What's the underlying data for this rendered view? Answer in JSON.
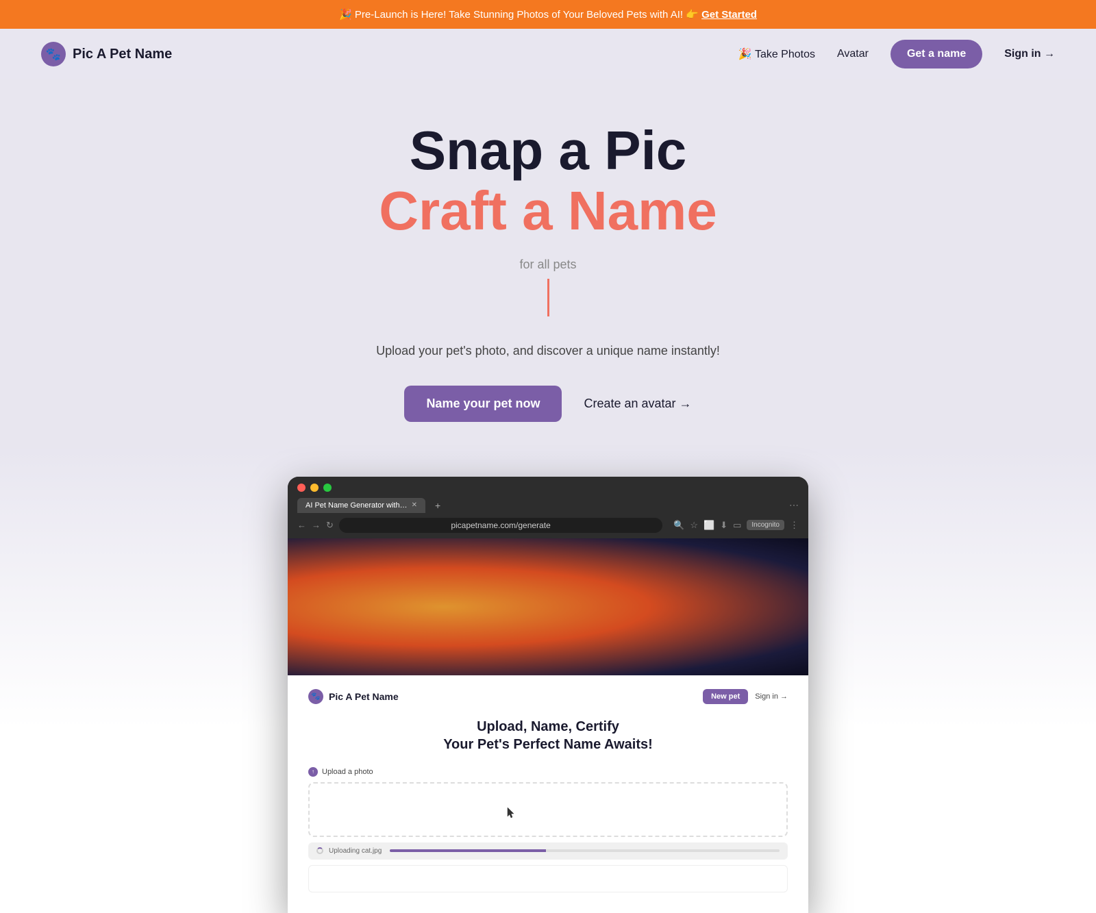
{
  "banner": {
    "text": "🎉 Pre-Launch is Here! Take Stunning Photos of Your Beloved Pets with AI! 👉 ",
    "link_text": "Get Started",
    "bg_color": "#f47820"
  },
  "nav": {
    "logo_text": "Pic A Pet Name",
    "logo_emoji": "🐾",
    "links": [
      {
        "label": "🎉 Take Photos",
        "id": "take-photos"
      },
      {
        "label": "Avatar",
        "id": "avatar"
      }
    ],
    "cta_label": "Get a name",
    "signin_label": "Sign in →"
  },
  "hero": {
    "line1": "Snap a Pic",
    "line2": "Craft a Name",
    "subtitle": "for all pets",
    "description": "Upload your pet's photo, and discover a unique name instantly!",
    "cta_primary": "Name your pet now",
    "cta_secondary": "Create an avatar →"
  },
  "mockup": {
    "tab_label": "AI Pet Name Generator with…",
    "url": "picapetname.com/generate",
    "incognito": "Incognito",
    "inner": {
      "logo": "Pic A Pet Name",
      "new_pet_btn": "New pet",
      "signin_btn": "Sign in →",
      "heading_line1": "Upload, Name, Certify",
      "heading_line2": "Your Pet's Perfect Name Awaits!",
      "upload_label": "Upload a photo",
      "upload_status": "Uploading cat.jpg"
    }
  }
}
